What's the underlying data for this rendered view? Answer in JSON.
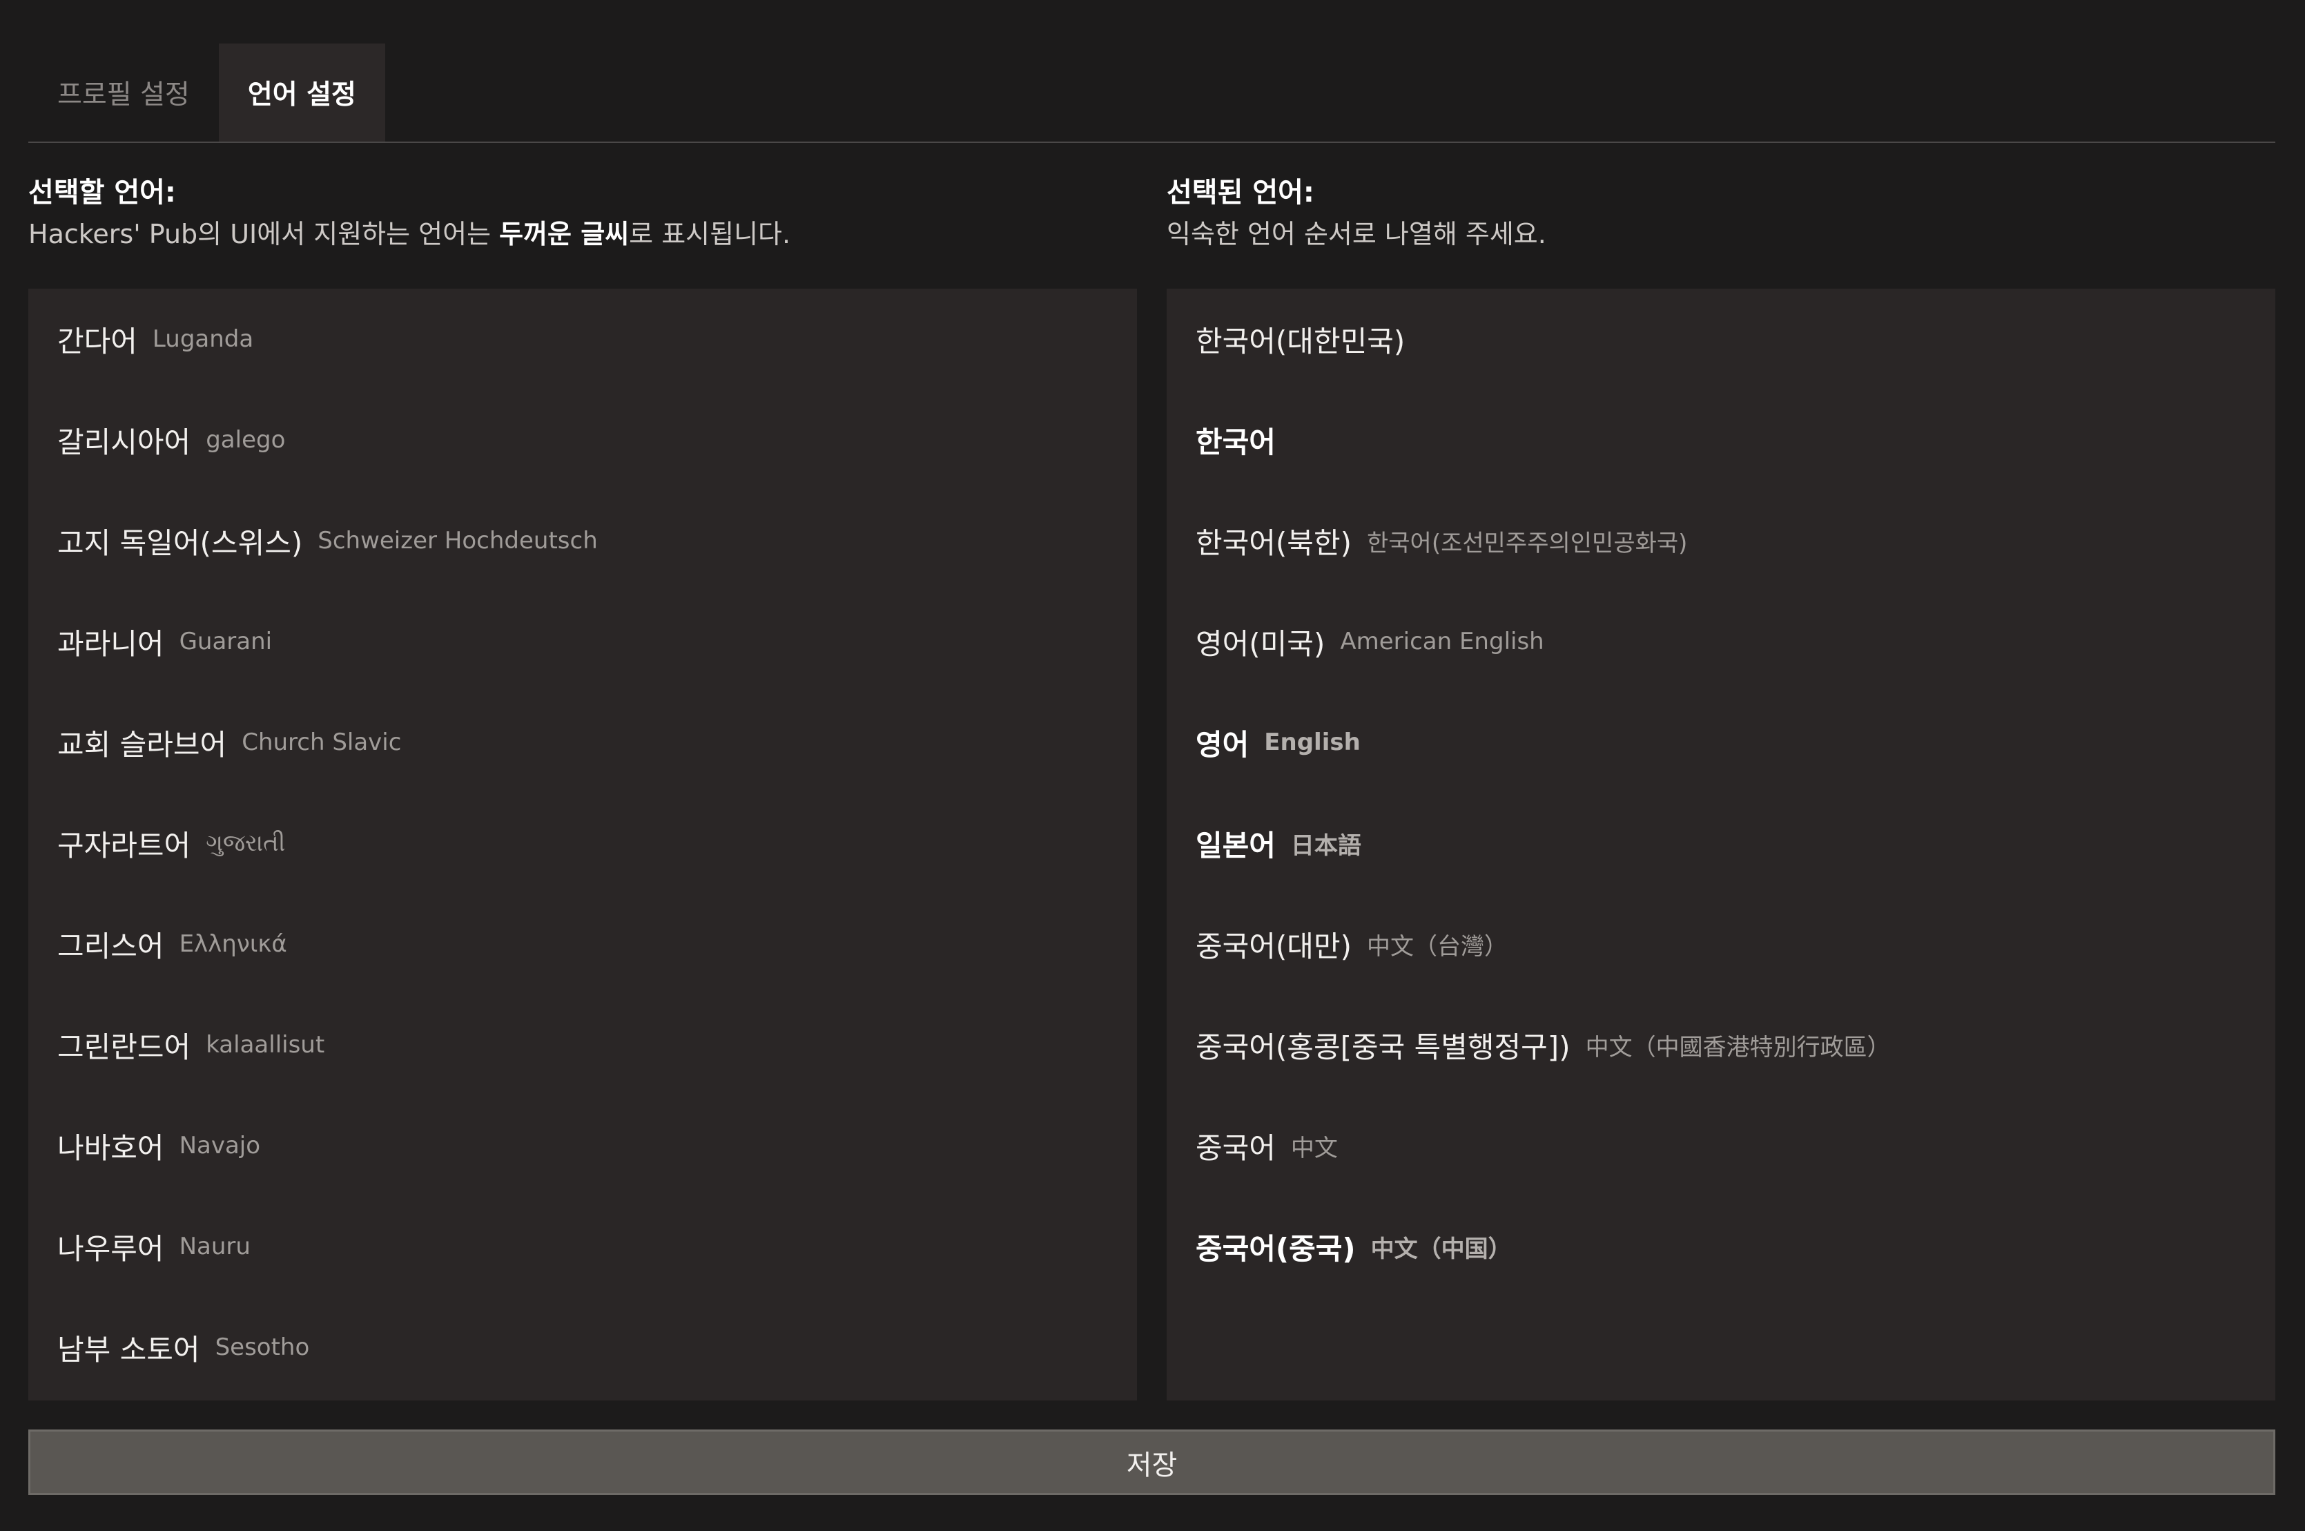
{
  "tabs": [
    {
      "label": "프로필 설정",
      "active": false
    },
    {
      "label": "언어 설정",
      "active": true
    }
  ],
  "available": {
    "title": "선택할 언어:",
    "desc_prefix": "Hackers' Pub의 UI에서 지원하는 언어는 ",
    "desc_bold": "두꺼운 글씨",
    "desc_suffix": "로 표시됩니다.",
    "items": [
      {
        "name": "간다어",
        "native": "Luganda"
      },
      {
        "name": "갈리시아어",
        "native": "galego"
      },
      {
        "name": "고지 독일어(스위스)",
        "native": "Schweizer Hochdeutsch"
      },
      {
        "name": "과라니어",
        "native": "Guarani"
      },
      {
        "name": "교회 슬라브어",
        "native": "Church Slavic"
      },
      {
        "name": "구자라트어",
        "native": "ગુજરાતી"
      },
      {
        "name": "그리스어",
        "native": "Ελληνικά"
      },
      {
        "name": "그린란드어",
        "native": "kalaallisut"
      },
      {
        "name": "나바호어",
        "native": "Navajo"
      },
      {
        "name": "나우루어",
        "native": "Nauru"
      },
      {
        "name": "남부 소토어",
        "native": "Sesotho"
      }
    ]
  },
  "selected": {
    "title": "선택된 언어:",
    "desc": "익숙한 언어 순서로 나열해 주세요.",
    "items": [
      {
        "name": "한국어(대한민국)",
        "native": "",
        "bold": false
      },
      {
        "name": "한국어",
        "native": "",
        "bold": true
      },
      {
        "name": "한국어(북한)",
        "native": "한국어(조선민주주의인민공화국)",
        "bold": false
      },
      {
        "name": "영어(미국)",
        "native": "American English",
        "bold": false
      },
      {
        "name": "영어",
        "native": "English",
        "bold": true
      },
      {
        "name": "일본어",
        "native": "日本語",
        "bold": true
      },
      {
        "name": "중국어(대만)",
        "native": "中文（台灣）",
        "bold": false
      },
      {
        "name": "중국어(홍콩[중국 특별행정구])",
        "native": "中文（中國香港特別行政區）",
        "bold": false
      },
      {
        "name": "중국어",
        "native": "中文",
        "bold": false
      },
      {
        "name": "중국어(중국)",
        "native": "中文（中国）",
        "bold": true
      }
    ]
  },
  "save_label": "저장"
}
